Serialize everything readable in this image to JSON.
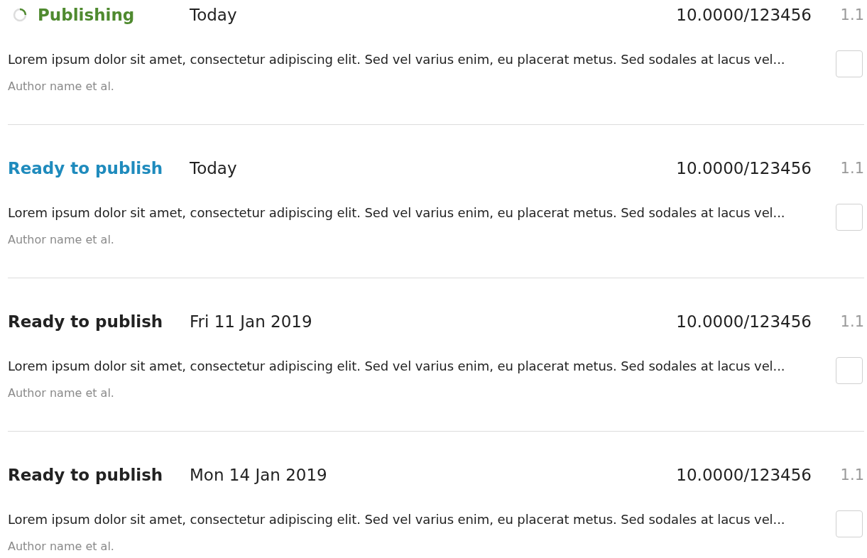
{
  "items": [
    {
      "status": {
        "label": "Publishing",
        "kind": "publishing",
        "color": "#4f8a2f"
      },
      "date": "Today",
      "doi": "10.0000/123456",
      "version": "1.1",
      "abstract": "Lorem ipsum dolor sit amet, consectetur adipiscing elit. Sed vel varius enim, eu placerat metus. Sed sodales at lacus vel...",
      "authors": "Author name et al.",
      "checked": false
    },
    {
      "status": {
        "label": "Ready to publish",
        "kind": "ready",
        "color": "#1f8bbd"
      },
      "date": "Today",
      "doi": "10.0000/123456",
      "version": "1.1",
      "abstract": "Lorem ipsum dolor sit amet, consectetur adipiscing elit. Sed vel varius enim, eu placerat metus. Sed sodales at lacus vel...",
      "authors": "Author name et al.",
      "checked": false
    },
    {
      "status": {
        "label": "Ready to publish",
        "kind": "ready",
        "color": "#222222"
      },
      "date": "Fri 11 Jan 2019",
      "doi": "10.0000/123456",
      "version": "1.1",
      "abstract": "Lorem ipsum dolor sit amet, consectetur adipiscing elit. Sed vel varius enim, eu placerat metus. Sed sodales at lacus vel...",
      "authors": "Author name et al.",
      "checked": false
    },
    {
      "status": {
        "label": "Ready to publish",
        "kind": "ready",
        "color": "#222222"
      },
      "date": "Mon 14 Jan 2019",
      "doi": "10.0000/123456",
      "version": "1.1",
      "abstract": "Lorem ipsum dolor sit amet, consectetur adipiscing elit. Sed vel varius enim, eu placerat metus. Sed sodales at lacus vel...",
      "authors": "Author name et al.",
      "checked": false
    }
  ]
}
